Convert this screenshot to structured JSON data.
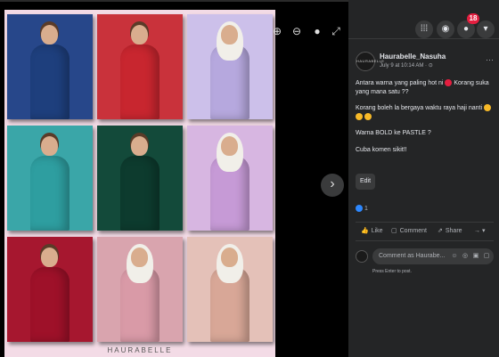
{
  "viewer": {
    "brand_text": "HAURABELLE",
    "zoom_in_icon": "zoom-in-icon",
    "zoom_out_icon": "zoom-out-icon",
    "tag_icon": "tag-icon",
    "fullscreen_icon": "fullscreen-icon",
    "next_icon": "chevron-right-icon",
    "zoom_in_glyph": "⊕",
    "zoom_out_glyph": "⊖",
    "tag_glyph": "●",
    "fullscreen_glyph": "⤢",
    "next_glyph": "›",
    "outfits": [
      {
        "color": "#1e3f7d",
        "hijab": false
      },
      {
        "color": "#c8262f",
        "hijab": false
      },
      {
        "color": "#b6a8de",
        "hijab": true
      },
      {
        "color": "#2e9ea0",
        "hijab": false
      },
      {
        "color": "#0d3b2e",
        "hijab": false
      },
      {
        "color": "#c69ad6",
        "hijab": true
      },
      {
        "color": "#9e1129",
        "hijab": false
      },
      {
        "color": "#d99aa7",
        "hijab": true
      },
      {
        "color": "#d8a797",
        "hijab": true
      }
    ],
    "tile_backgrounds": [
      "#27478a",
      "#c9323b",
      "#ccc0ea",
      "#3aa6a8",
      "#134a3a",
      "#d7b6e1",
      "#a6172f",
      "#d9a4ae",
      "#e4c1b8"
    ]
  },
  "panel": {
    "menu_glyph": "⁞⁞⁞",
    "messenger_glyph": "◉",
    "notification_glyph": "●",
    "account_glyph": "▾",
    "notification_count": "18",
    "page_name": "Haurabelle_Nasuha",
    "avatar_text": "HAURABELLE",
    "post_time": "July 9 at 10:14 AM · ⊙",
    "more_glyph": "···",
    "caption_1": "Antara warna yang paling hot ni",
    "caption_1b": " Korang suka yang mana satu ??",
    "caption_2": "Korang boleh la bergaya waktu raya haji nanti",
    "caption_3": "Warna BOLD ke PASTLE ?",
    "caption_4": "Cuba komen sikit!!",
    "edit_label": "Edit",
    "like_glyph": "👍",
    "reaction_count": "1",
    "actions": {
      "like": "Like",
      "comment": "Comment",
      "share": "Share",
      "like_glyph": "👍",
      "comment_glyph": "▢",
      "share_glyph": "⇗",
      "more_glyph": "→ ▾"
    },
    "comment_placeholder": "Comment as Haurabe...",
    "comment_icons": {
      "emoji": "☺",
      "camera": "◎",
      "gif": "▣",
      "sticker": "▢"
    },
    "press_enter": "Press Enter to post.",
    "colors": {
      "accent": "#2d88ff",
      "badge": "#e41e3f",
      "panel_bg": "#242526"
    }
  }
}
